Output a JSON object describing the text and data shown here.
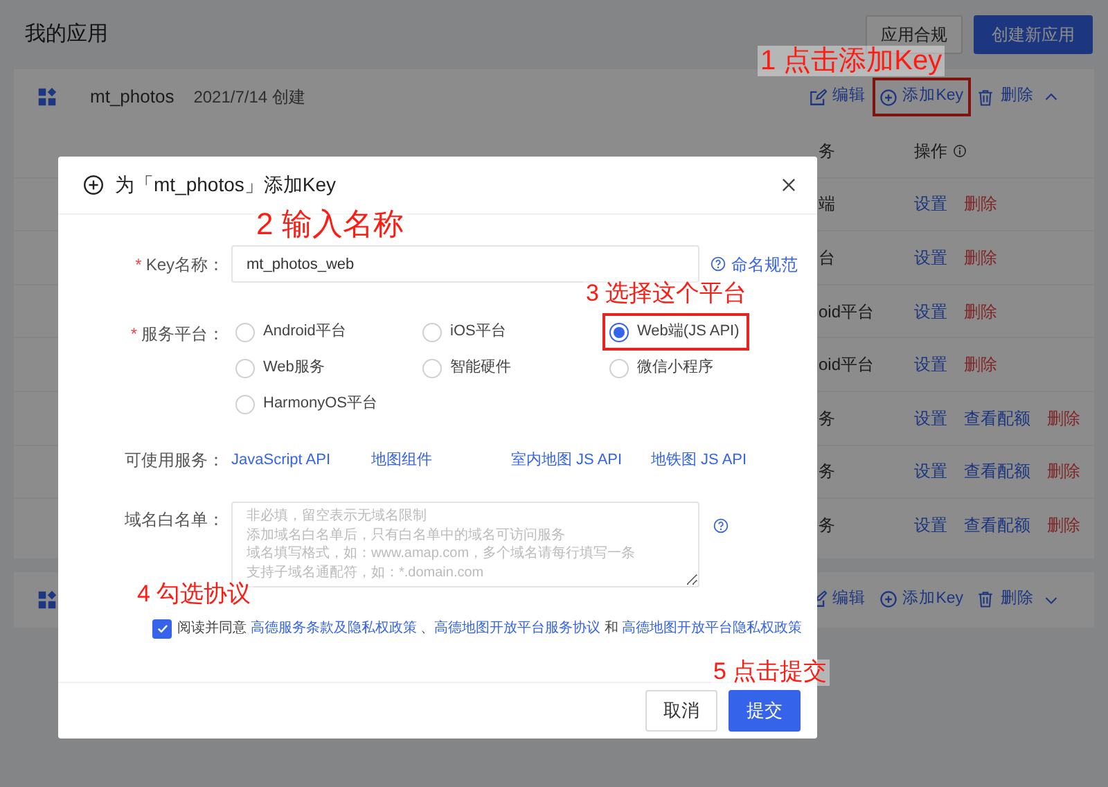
{
  "page": {
    "title": "我的应用",
    "buttons": [
      {
        "label": "应用合规",
        "kind": "secondary"
      },
      {
        "label": "创建新应用",
        "kind": "primary"
      }
    ]
  },
  "apps": [
    {
      "name": "mt_photos",
      "created": "2021/7/14 创建",
      "expanded": true,
      "actions": [
        {
          "label": "编辑",
          "kind": "edit",
          "highlighted": false
        },
        {
          "label": "添加Key",
          "kind": "add",
          "highlighted": true
        },
        {
          "label": "删除",
          "kind": "delete",
          "highlighted": false
        }
      ],
      "table": {
        "columns": [
          "务",
          "操作"
        ],
        "rows": [
          {
            "service": "端",
            "actions": [
              {
                "label": "设置",
                "kind": "link"
              },
              {
                "label": "删除",
                "kind": "danger"
              }
            ]
          },
          {
            "service": "台",
            "actions": [
              {
                "label": "设置",
                "kind": "link"
              },
              {
                "label": "删除",
                "kind": "danger"
              }
            ]
          },
          {
            "service": "oid平台",
            "actions": [
              {
                "label": "设置",
                "kind": "link"
              },
              {
                "label": "删除",
                "kind": "danger"
              }
            ]
          },
          {
            "service": "oid平台",
            "actions": [
              {
                "label": "设置",
                "kind": "link"
              },
              {
                "label": "删除",
                "kind": "danger"
              }
            ]
          },
          {
            "service": "务",
            "actions": [
              {
                "label": "设置",
                "kind": "link"
              },
              {
                "label": "查看配额",
                "kind": "link"
              },
              {
                "label": "删除",
                "kind": "danger"
              }
            ]
          },
          {
            "service": "务",
            "actions": [
              {
                "label": "设置",
                "kind": "link"
              },
              {
                "label": "查看配额",
                "kind": "link"
              },
              {
                "label": "删除",
                "kind": "danger"
              }
            ]
          },
          {
            "service": "务",
            "actions": [
              {
                "label": "设置",
                "kind": "link"
              },
              {
                "label": "查看配额",
                "kind": "link"
              },
              {
                "label": "删除",
                "kind": "danger"
              }
            ]
          }
        ]
      }
    },
    {
      "expanded": false,
      "actions": [
        {
          "label": "编辑",
          "kind": "edit",
          "highlighted": false
        },
        {
          "label": "添加Key",
          "kind": "add",
          "highlighted": false
        },
        {
          "label": "删除",
          "kind": "delete",
          "highlighted": false
        }
      ]
    }
  ],
  "modal": {
    "title": "为「mt_photos」添加Key",
    "key_name": {
      "marker": "*",
      "label": "Key名称：",
      "value": "mt_photos_web",
      "help": "命名规范"
    },
    "platform": {
      "marker": "*",
      "label": "服务平台：",
      "options": [
        {
          "label": "Android平台",
          "selected": false,
          "highlighted": false
        },
        {
          "label": "iOS平台",
          "selected": false,
          "highlighted": false
        },
        {
          "label": "Web端(JS API)",
          "selected": true,
          "highlighted": true
        },
        {
          "label": "Web服务",
          "selected": false,
          "highlighted": false
        },
        {
          "label": "智能硬件",
          "selected": false,
          "highlighted": false
        },
        {
          "label": "微信小程序",
          "selected": false,
          "highlighted": false
        },
        {
          "label": "HarmonyOS平台",
          "selected": false,
          "highlighted": false
        }
      ]
    },
    "services": {
      "label": "可使用服务：",
      "links": [
        "JavaScript API",
        "地图组件",
        "室内地图 JS API",
        "地铁图 JS API"
      ]
    },
    "whitelist": {
      "label": "域名白名单：",
      "placeholder": [
        "非必填，留空表示无域名限制",
        "添加域名白名单后，只有白名单中的域名可访问服务",
        "域名填写格式，如：www.amap.com，多个域名请每行填写一条",
        "支持子域名通配符，如：*.domain.com"
      ]
    },
    "agreement": {
      "checked": true,
      "parts": [
        {
          "kind": "text",
          "text": "阅读并同意 "
        },
        {
          "kind": "link",
          "text": "高德服务条款及隐私权政策"
        },
        {
          "kind": "text",
          "text": " 、"
        },
        {
          "kind": "link",
          "text": "高德地图开放平台服务协议"
        },
        {
          "kind": "text",
          "text": " 和 "
        },
        {
          "kind": "link",
          "text": "高德地图开放平台隐私权政策"
        }
      ]
    },
    "buttons": [
      {
        "label": "取消",
        "kind": "secondary"
      },
      {
        "label": "提交",
        "kind": "primary"
      }
    ]
  },
  "annotations": [
    "1 点击添加Key",
    "2 输入名称",
    "3 选择这个平台",
    "4 勾选协议",
    "5 点击提交"
  ]
}
